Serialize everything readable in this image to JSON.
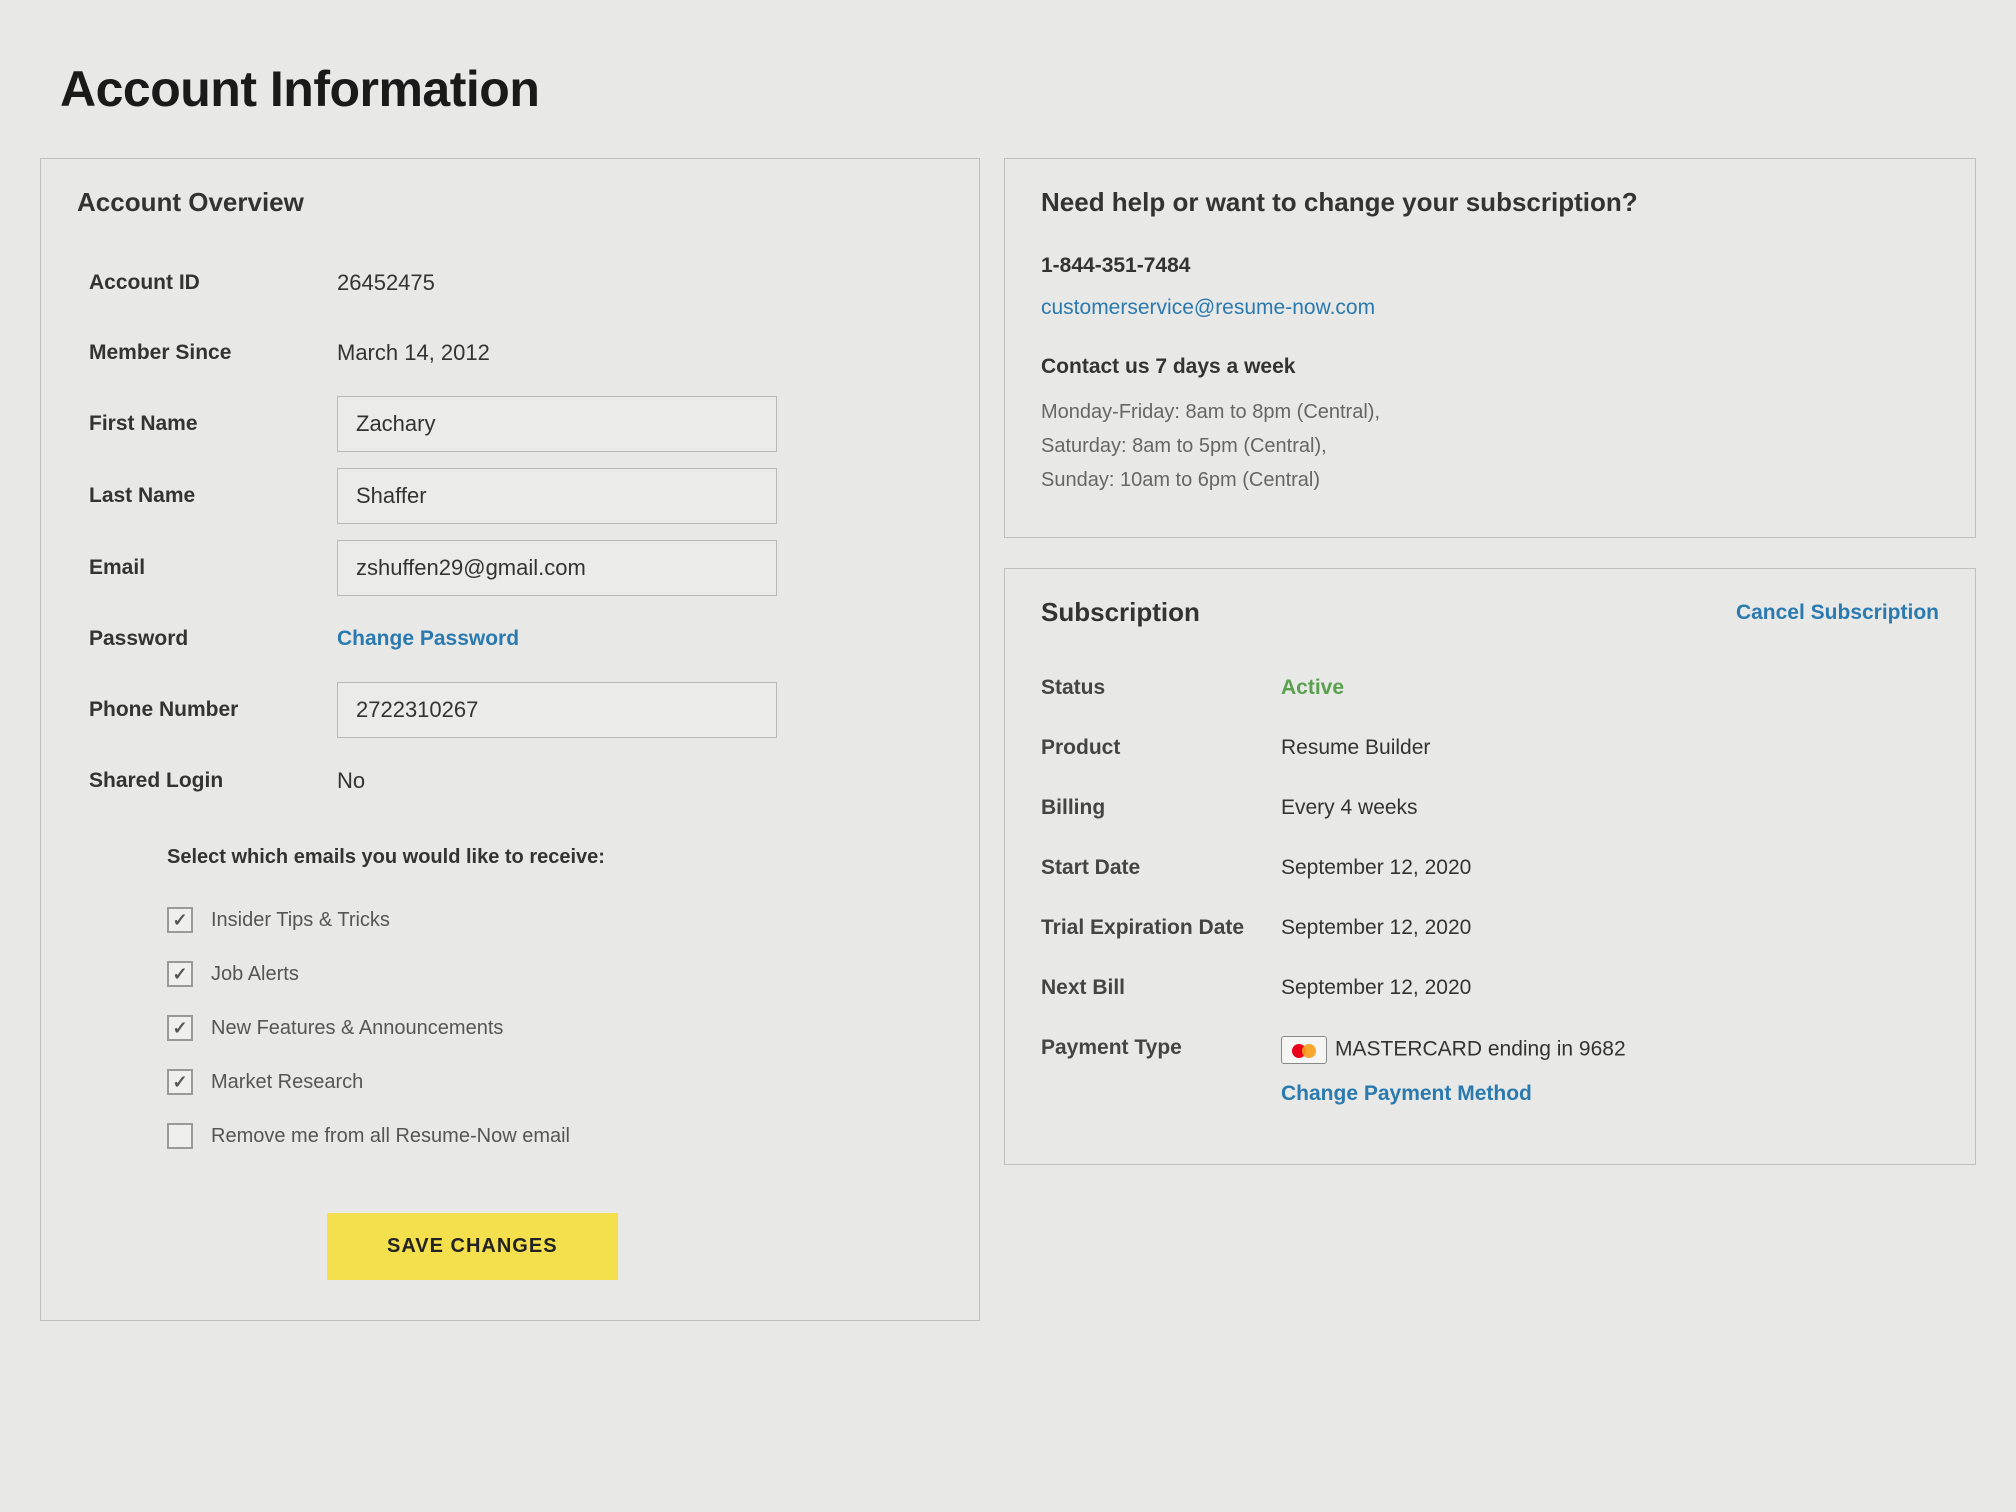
{
  "pageTitle": "Account Information",
  "overview": {
    "title": "Account Overview",
    "labels": {
      "accountId": "Account ID",
      "memberSince": "Member Since",
      "firstName": "First Name",
      "lastName": "Last Name",
      "email": "Email",
      "password": "Password",
      "phone": "Phone Number",
      "sharedLogin": "Shared Login"
    },
    "values": {
      "accountId": "26452475",
      "memberSince": "March 14, 2012",
      "firstName": "Zachary",
      "lastName": "Shaffer",
      "email": "zshuffen29@gmail.com",
      "changePasswordLink": "Change Password",
      "phone": "2722310267",
      "sharedLogin": "No"
    },
    "emailPrefs": {
      "title": "Select which emails you would like to receive:",
      "options": [
        {
          "label": "Insider Tips & Tricks",
          "checked": true
        },
        {
          "label": "Job Alerts",
          "checked": true
        },
        {
          "label": "New Features & Announcements",
          "checked": true
        },
        {
          "label": "Market Research",
          "checked": true
        },
        {
          "label": "Remove me from all Resume-Now email",
          "checked": false
        }
      ]
    },
    "saveButton": "SAVE CHANGES"
  },
  "help": {
    "title": "Need help or want to change your subscription?",
    "phone": "1-844-351-7484",
    "email": "customerservice@resume-now.com",
    "contactSub": "Contact us 7 days a week",
    "hoursLine1": "Monday-Friday: 8am to 8pm (Central),",
    "hoursLine2": "Saturday: 8am to 5pm (Central),",
    "hoursLine3": "Sunday: 10am to 6pm (Central)"
  },
  "subscription": {
    "title": "Subscription",
    "cancelLink": "Cancel Subscription",
    "labels": {
      "status": "Status",
      "product": "Product",
      "billing": "Billing",
      "startDate": "Start Date",
      "trialExp": "Trial Expiration Date",
      "nextBill": "Next Bill",
      "paymentType": "Payment Type"
    },
    "values": {
      "status": "Active",
      "product": "Resume Builder",
      "billing": "Every 4 weeks",
      "startDate": "September 12, 2020",
      "trialExp": "September 12, 2020",
      "nextBill": "September 12, 2020",
      "paymentCard": "MASTERCARD ending in 9682",
      "changePayment": "Change Payment Method"
    }
  }
}
